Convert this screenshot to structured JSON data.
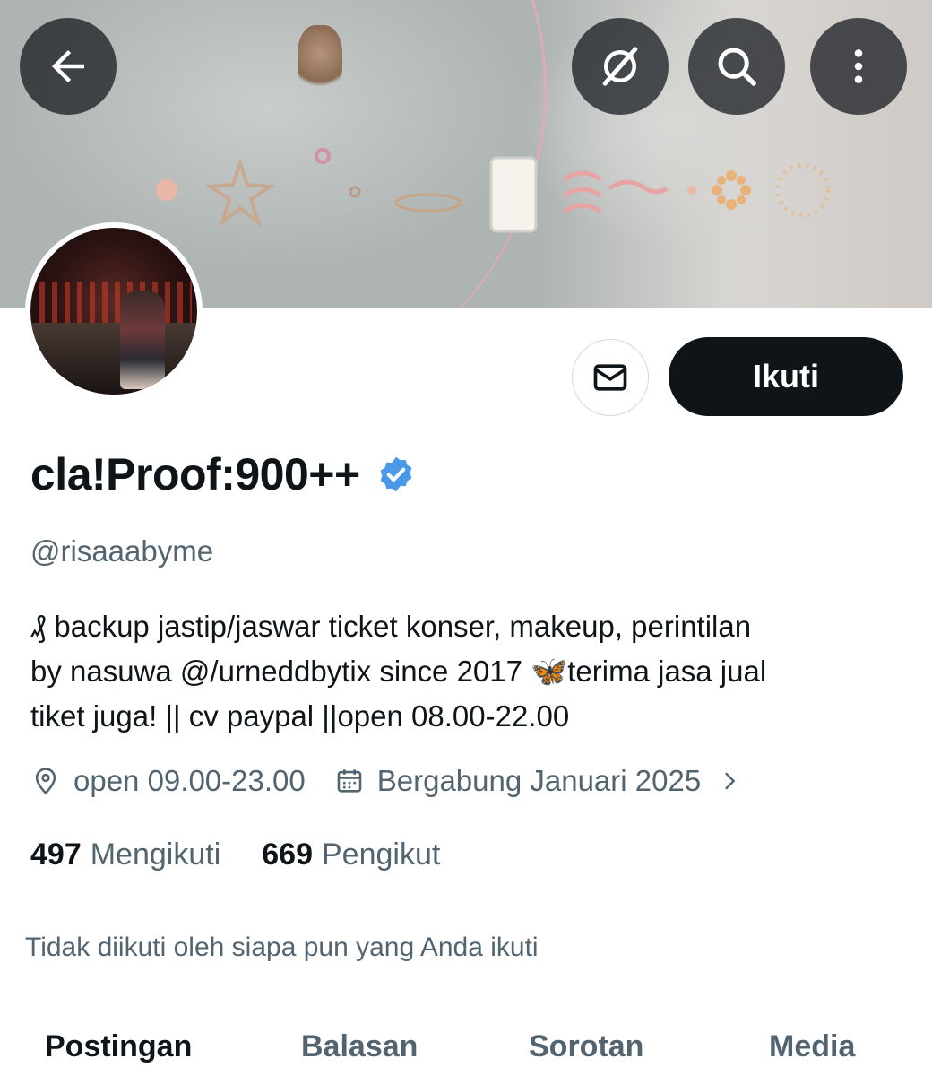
{
  "header": {
    "back_icon": "arrow-left-icon",
    "grok_icon": "grok-icon",
    "search_icon": "search-icon",
    "more_icon": "more-vertical-icon"
  },
  "profile": {
    "display_name": "cla!Proof:900++",
    "verified": true,
    "handle": "@risaaabyme",
    "bio_lines": [
      "₰ backup jastip/jaswar ticket konser, makeup, perintilan",
      "by nasuwa @/urneddbytix since 2017 🦋terima jasa jual",
      "tiket juga! || cv paypal ||open 08.00-22.00"
    ],
    "location": "open 09.00-23.00",
    "joined": "Bergabung Januari 2025",
    "following_count": "497",
    "following_label": "Mengikuti",
    "followers_count": "669",
    "followers_label": "Pengikut",
    "followed_by_note": "Tidak diikuti oleh siapa pun yang Anda ikuti"
  },
  "actions": {
    "message_icon": "mail-icon",
    "follow_label": "Ikuti"
  },
  "tabs": [
    {
      "label": "Postingan",
      "active": true
    },
    {
      "label": "Balasan",
      "active": false
    },
    {
      "label": "Sorotan",
      "active": false
    },
    {
      "label": "Media",
      "active": false
    }
  ],
  "colors": {
    "accent_verified": "#4a99e9",
    "text_primary": "#0f1419",
    "text_secondary": "#536471"
  }
}
